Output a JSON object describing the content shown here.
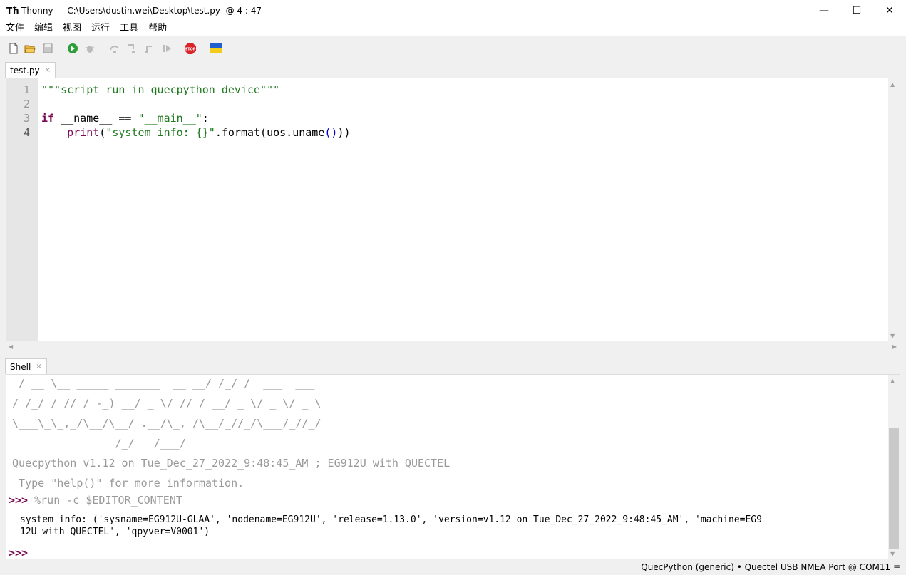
{
  "window": {
    "app_name": "Thonny",
    "title_sep": "-",
    "file_path": "C:\\Users\\dustin.wei\\Desktop\\test.py",
    "title_suffix": "@ 4 : 47",
    "minimize": "—",
    "maximize": "☐",
    "close": "✕"
  },
  "menu": [
    "文件",
    "编辑",
    "视图",
    "运行",
    "工具",
    "帮助"
  ],
  "toolbar": {
    "icons": [
      "new-file-icon",
      "open-folder-icon",
      "save-icon",
      "run-icon",
      "debug-icon",
      "step-over-icon",
      "step-into-icon",
      "step-out-icon",
      "resume-icon",
      "stop-icon",
      "ukraine-flag-icon"
    ]
  },
  "editor_tab": {
    "label": "test.py",
    "close": "×"
  },
  "editor": {
    "line_numbers": [
      "1",
      "2",
      "3",
      "4"
    ],
    "line1": "\"\"\"script run in quecpython device\"\"\"",
    "line3_kw": "if",
    "line3_rest": " __name__ == ",
    "line3_str": "\"__main__\"",
    "line3_end": ":",
    "line4_indent": "    ",
    "line4_fn": "print",
    "line4_open": "(",
    "line4_str": "\"system info: {}\"",
    "line4_mid": ".format(uos.uname",
    "line4_paren": "()",
    "line4_close": "))"
  },
  "shell_tab": {
    "label": "Shell",
    "close": "×"
  },
  "shell": {
    "art1": "  / __ \\__ _____ _______  __ __/ /_/ /  ___  ___",
    "art2": " / /_/ / // / -_) __/ _ \\/ // / __/ _ \\/ _ \\/ _ \\",
    "art3": " \\___\\_\\_,_/\\__/\\__/ .__/\\_, /\\__/_//_/\\___/_//_/",
    "art4": "                 /_/   /___/",
    "version": " Quecpython v1.12 on Tue_Dec_27_2022_9:48:45_AM ; EG912U with QUECTEL",
    "help": "  Type \"help()\" for more information.",
    "prompt": ">>>",
    "command": " %run -c $EDITOR_CONTENT",
    "output1": "system info: ('sysname=EG912U-GLAA', 'nodename=EG912U', 'release=1.13.0', 'version=v1.12 on Tue_Dec_27_2022_9:48:45_AM', 'machine=EG9",
    "output2": "12U with QUECTEL', 'qpyver=V0001')",
    "prompt2": ">>>"
  },
  "status": {
    "text": "QuecPython (generic)  •  Quectel USB NMEA Port @ COM11  ≡"
  }
}
